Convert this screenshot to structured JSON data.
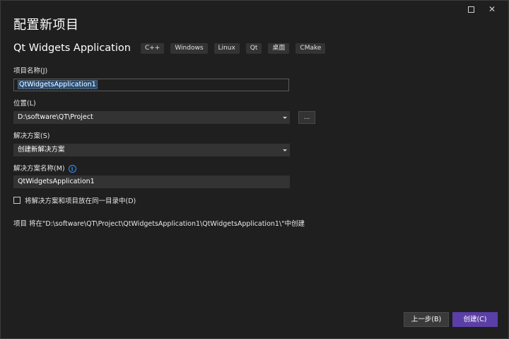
{
  "window": {
    "maximize_icon": "maximize-icon",
    "close_icon": "close-icon",
    "close_glyph": "✕"
  },
  "page": {
    "title": "配置新项目",
    "template_name": "Qt Widgets Application",
    "tags": [
      "C++",
      "Windows",
      "Linux",
      "Qt",
      "桌面",
      "CMake"
    ]
  },
  "form": {
    "project_name_label": "项目名称(J)",
    "project_name_value": "QtWidgetsApplication1",
    "location_label": "位置(L)",
    "location_value": "D:\\software\\QT\\Project",
    "browse_label": "...",
    "solution_label": "解决方案(S)",
    "solution_value": "创建新解决方案",
    "solution_name_label": "解决方案名称(M)",
    "solution_name_value": "QtWidgetsApplication1",
    "same_dir_label": "将解决方案和项目放在同一目录中(D)",
    "same_dir_checked": false,
    "note": "项目 将在\"D:\\software\\QT\\Project\\QtWidgetsApplication1\\QtWidgetsApplication1\\\"中创建"
  },
  "footer": {
    "back_label": "上一步(B)",
    "create_label": "创建(C)"
  },
  "colors": {
    "background": "#1f1f1f",
    "primary_button": "#5b3fa6",
    "selection": "#264f78",
    "info_icon": "#3794ff"
  }
}
